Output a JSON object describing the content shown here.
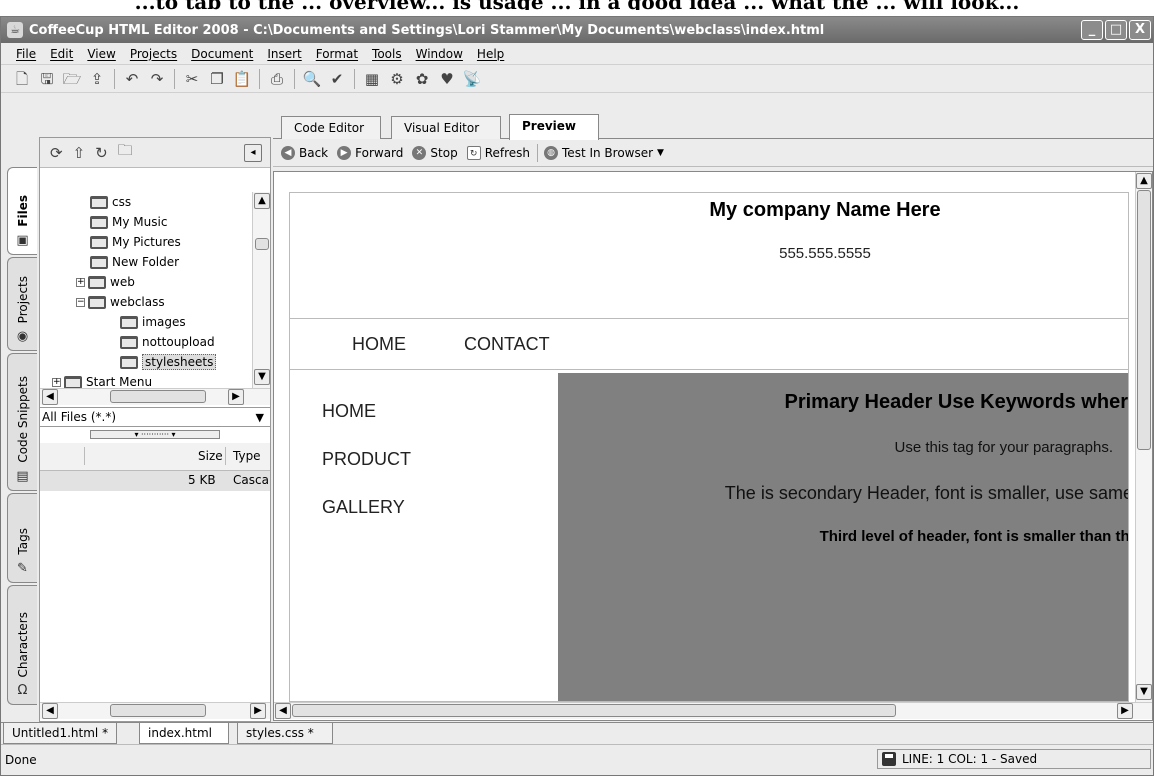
{
  "caption": "...to tab to the ... overview... is usage ... in a good idea ... what the ... will look...",
  "window": {
    "title": "CoffeeCup HTML Editor 2008 - C:\\Documents and Settings\\Lori Stammer\\My Documents\\webclass\\index.html",
    "btn_min": "_",
    "btn_max": "□",
    "btn_close": "X"
  },
  "menu": [
    "File",
    "Edit",
    "View",
    "Projects",
    "Document",
    "Insert",
    "Format",
    "Tools",
    "Window",
    "Help"
  ],
  "side_tabs": [
    "Files",
    "Projects",
    "Code Snippets",
    "Tags",
    "Characters"
  ],
  "tree": {
    "items": [
      "css",
      "My Music",
      "My Pictures",
      "New Folder",
      "web",
      "webclass",
      "images",
      "nottoupload",
      "stylesheets",
      "Start Menu"
    ]
  },
  "file_filter": "All Files (*.*)",
  "grid": {
    "headers": [
      "Size",
      "Type"
    ],
    "row": {
      "size": "5 KB",
      "type": "Casca"
    }
  },
  "editor_tabs": [
    "Code Editor",
    "Visual Editor",
    "Preview"
  ],
  "browser": {
    "back": "Back",
    "forward": "Forward",
    "stop": "Stop",
    "refresh": "Refresh",
    "test": "Test In Browser"
  },
  "preview": {
    "company": "My company Name Here",
    "phone": "555.555.5555",
    "nav": [
      "HOME",
      "CONTACT"
    ],
    "side": [
      "HOME",
      "PRODUCT",
      "GALLERY"
    ],
    "h1": "Primary Header Use Keywords wher",
    "p": "Use this tag for your paragraphs.",
    "h2": "The is secondary Header, font is smaller, use same",
    "h3": "Third level of header, font is smaller than the"
  },
  "doc_tabs": [
    "Untitled1.html *",
    "index.html",
    "styles.css *"
  ],
  "status": {
    "left": "Done",
    "right": "LINE: 1  COL: 1 - Saved"
  }
}
